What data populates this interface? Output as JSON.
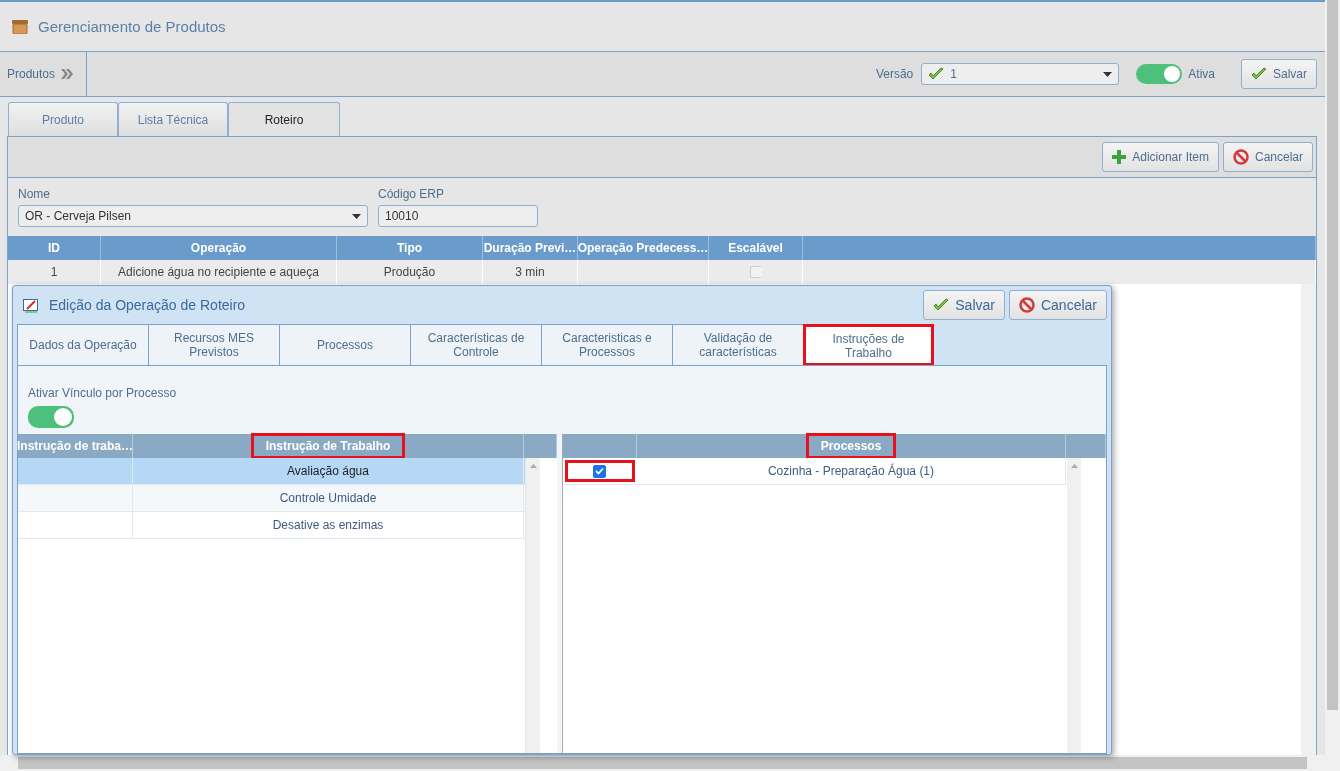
{
  "page": {
    "title": "Gerenciamento de Produtos"
  },
  "toolbar": {
    "breadcrumb": "Produtos",
    "version_label": "Versão",
    "version_value": "1",
    "toggle": {
      "label": "Ativa",
      "on": true
    },
    "save_button": "Salvar"
  },
  "main_tabs": [
    {
      "label": "Produto",
      "selected": false
    },
    {
      "label": "Lista Técnica",
      "selected": false
    },
    {
      "label": "Roteiro",
      "selected": true
    }
  ],
  "panel_buttons": [
    {
      "kind": "add",
      "label": "Adicionar Item"
    },
    {
      "kind": "cancel",
      "label": "Cancelar"
    }
  ],
  "form": {
    "fields": [
      {
        "kind": "select",
        "label": "Nome",
        "value": "OR - Cerveja Pilsen"
      },
      {
        "kind": "text",
        "label": "Código ERP",
        "value": "10010"
      }
    ]
  },
  "table": {
    "columns": [
      "ID",
      "Operação",
      "Tipo",
      "Duração Previ…",
      "Operação Predecess…",
      "Escalável"
    ],
    "rows": [
      {
        "id": "1",
        "operation": "Adicione água no recipiente e aqueça",
        "type": "Produção",
        "duration": "3 min",
        "scalable": {
          "checked": false,
          "disabled": true
        }
      }
    ]
  },
  "dialog": {
    "title": "Edição da Operação de Roteiro",
    "buttons": [
      {
        "kind": "save",
        "label": "Salvar"
      },
      {
        "kind": "cancel",
        "label": "Cancelar"
      }
    ],
    "tabs": [
      {
        "label": "Dados da Operação",
        "selected": false,
        "highlighted": false
      },
      {
        "label": "Recursos MES Previstos",
        "selected": false,
        "highlighted": false
      },
      {
        "label": "Processos",
        "selected": false,
        "highlighted": false
      },
      {
        "label": "Características de Controle",
        "selected": false,
        "highlighted": false
      },
      {
        "label": "Caracteristicas e Processos",
        "selected": false,
        "highlighted": false
      },
      {
        "label": "Validação de características",
        "selected": false,
        "highlighted": false
      },
      {
        "label": "Instruções de Trabalho",
        "selected": true,
        "highlighted": true
      }
    ],
    "link_toggle": {
      "label": "Ativar Vínculo por Processo",
      "on": true
    },
    "instructions": {
      "columns": [
        {
          "label": "Instrução de traba…",
          "highlighted": false
        },
        {
          "label": "Instrução de Trabalho",
          "highlighted": true
        }
      ],
      "rows": [
        {
          "name": "Avaliação água",
          "selected": true
        },
        {
          "name": "Controle Umidade",
          "selected": false
        },
        {
          "name": "Desative as enzimas",
          "selected": false
        }
      ]
    },
    "processes": {
      "columns": [
        {
          "label": "Processos",
          "highlighted": true
        }
      ],
      "rows": [
        {
          "name": "Cozinha - Preparação Água (1)",
          "checked": true,
          "highlighted": true
        }
      ]
    }
  }
}
